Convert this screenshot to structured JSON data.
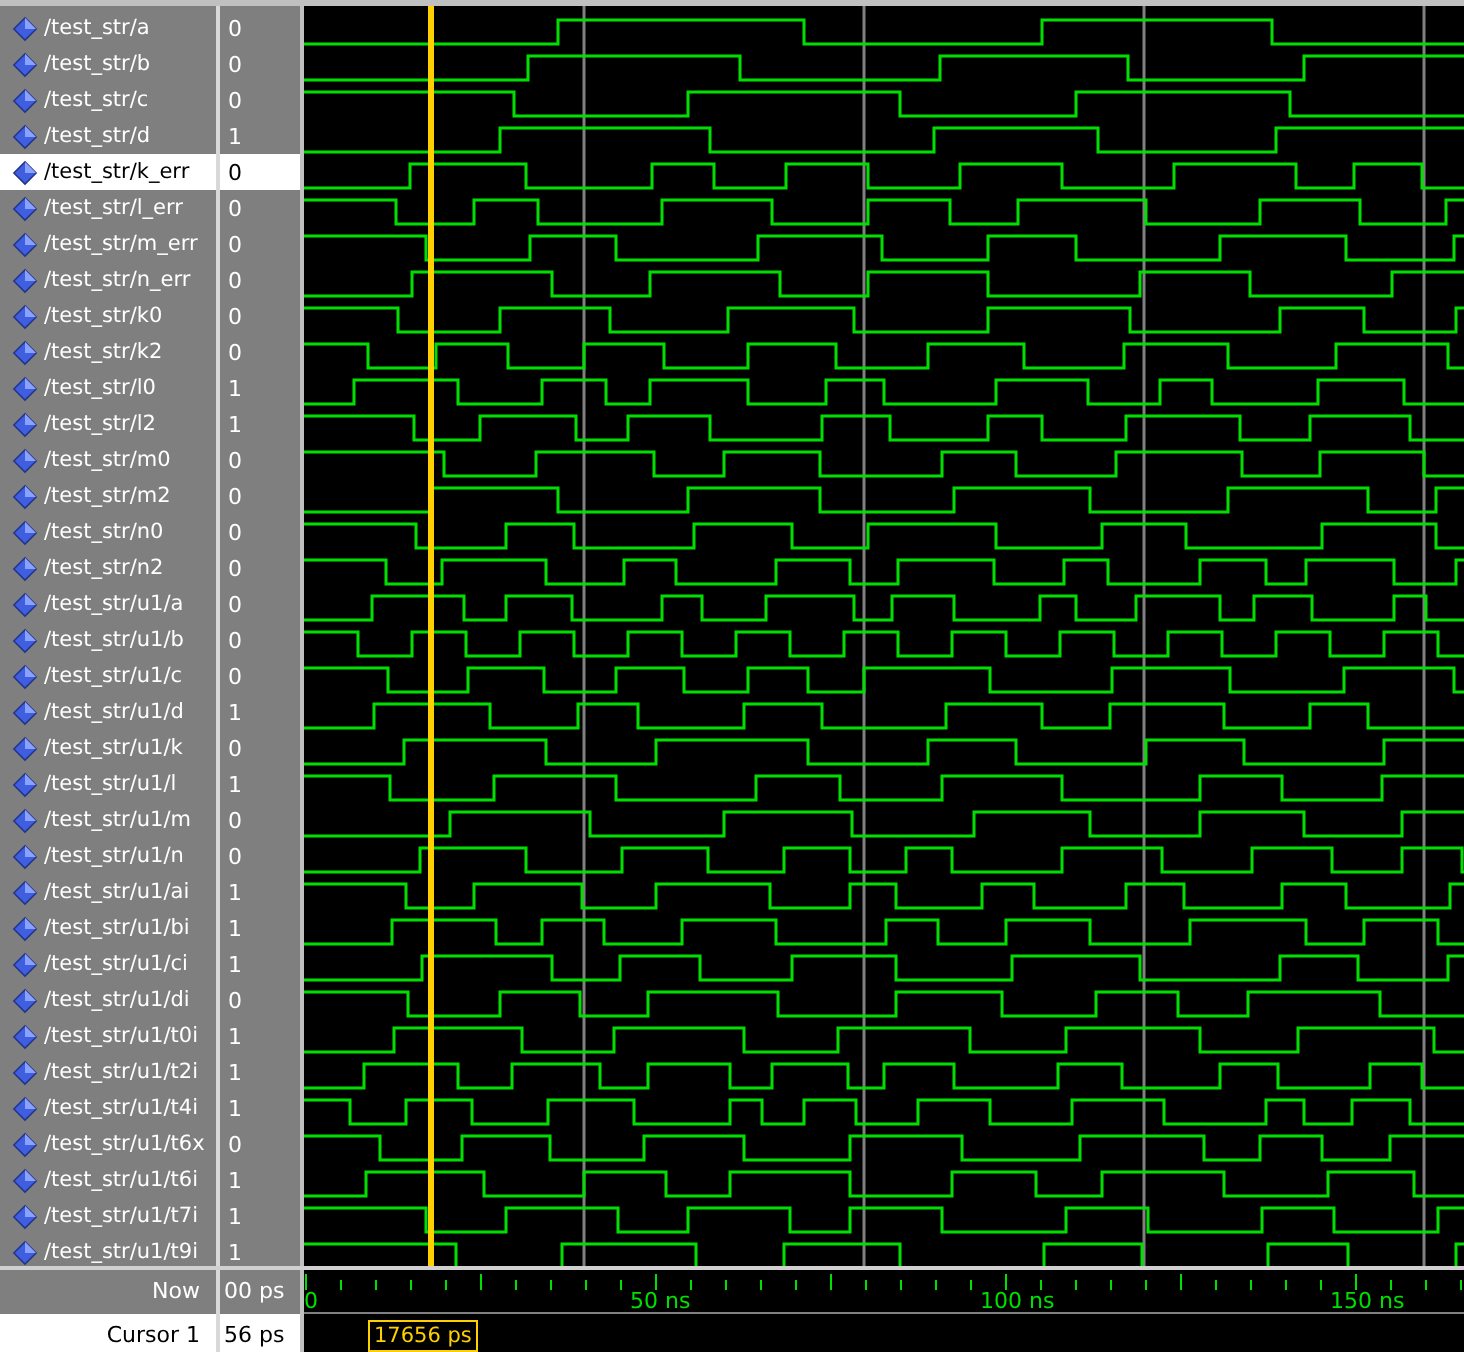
{
  "signals": [
    {
      "name": "/test_str/a",
      "value": "0",
      "selected": false
    },
    {
      "name": "/test_str/b",
      "value": "0",
      "selected": false
    },
    {
      "name": "/test_str/c",
      "value": "0",
      "selected": false
    },
    {
      "name": "/test_str/d",
      "value": "1",
      "selected": false
    },
    {
      "name": "/test_str/k_err",
      "value": "0",
      "selected": true
    },
    {
      "name": "/test_str/l_err",
      "value": "0",
      "selected": false
    },
    {
      "name": "/test_str/m_err",
      "value": "0",
      "selected": false
    },
    {
      "name": "/test_str/n_err",
      "value": "0",
      "selected": false
    },
    {
      "name": "/test_str/k0",
      "value": "0",
      "selected": false
    },
    {
      "name": "/test_str/k2",
      "value": "0",
      "selected": false
    },
    {
      "name": "/test_str/l0",
      "value": "1",
      "selected": false
    },
    {
      "name": "/test_str/l2",
      "value": "1",
      "selected": false
    },
    {
      "name": "/test_str/m0",
      "value": "0",
      "selected": false
    },
    {
      "name": "/test_str/m2",
      "value": "0",
      "selected": false
    },
    {
      "name": "/test_str/n0",
      "value": "0",
      "selected": false
    },
    {
      "name": "/test_str/n2",
      "value": "0",
      "selected": false
    },
    {
      "name": "/test_str/u1/a",
      "value": "0",
      "selected": false
    },
    {
      "name": "/test_str/u1/b",
      "value": "0",
      "selected": false
    },
    {
      "name": "/test_str/u1/c",
      "value": "0",
      "selected": false
    },
    {
      "name": "/test_str/u1/d",
      "value": "1",
      "selected": false
    },
    {
      "name": "/test_str/u1/k",
      "value": "0",
      "selected": false
    },
    {
      "name": "/test_str/u1/l",
      "value": "1",
      "selected": false
    },
    {
      "name": "/test_str/u1/m",
      "value": "0",
      "selected": false
    },
    {
      "name": "/test_str/u1/n",
      "value": "0",
      "selected": false
    },
    {
      "name": "/test_str/u1/ai",
      "value": "1",
      "selected": false
    },
    {
      "name": "/test_str/u1/bi",
      "value": "1",
      "selected": false
    },
    {
      "name": "/test_str/u1/ci",
      "value": "1",
      "selected": false
    },
    {
      "name": "/test_str/u1/di",
      "value": "0",
      "selected": false
    },
    {
      "name": "/test_str/u1/t0i",
      "value": "1",
      "selected": false
    },
    {
      "name": "/test_str/u1/t2i",
      "value": "1",
      "selected": false
    },
    {
      "name": "/test_str/u1/t4i",
      "value": "1",
      "selected": false
    },
    {
      "name": "/test_str/u1/t6x",
      "value": "0",
      "selected": false
    },
    {
      "name": "/test_str/u1/t6i",
      "value": "1",
      "selected": false
    },
    {
      "name": "/test_str/u1/t7i",
      "value": "1",
      "selected": false
    },
    {
      "name": "/test_str/u1/t9i",
      "value": "1",
      "selected": false
    }
  ],
  "now": {
    "label": "Now",
    "value": "00 ps"
  },
  "cursor": {
    "label": "Cursor 1",
    "value": "56 ps",
    "time": "17656 ps"
  },
  "timeline": {
    "labels": [
      "0",
      "50 ns",
      "100 ns",
      "150 ns"
    ]
  }
}
